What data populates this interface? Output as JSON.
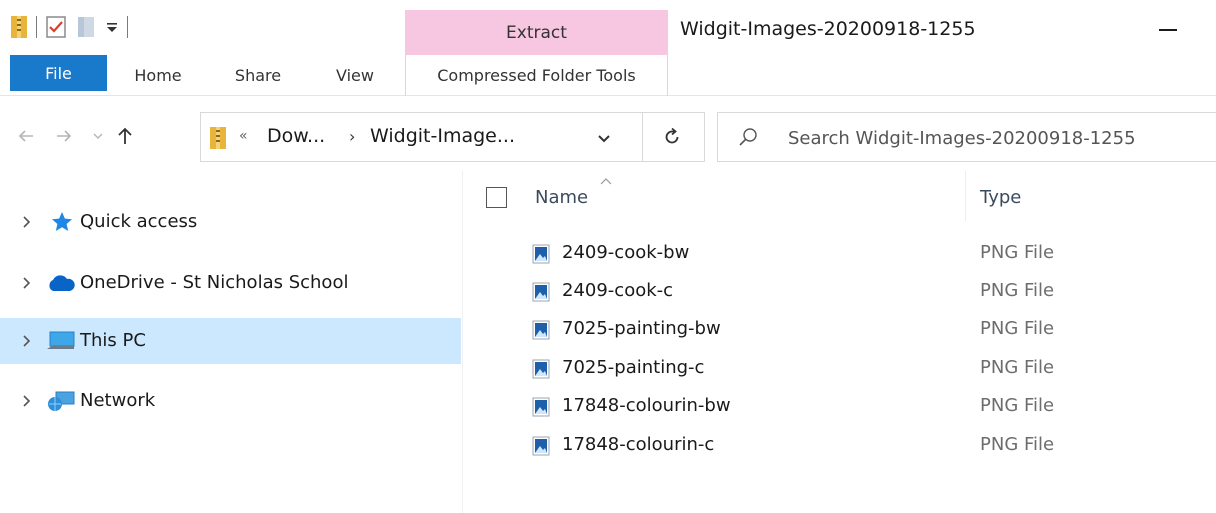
{
  "window": {
    "title": "Widgit-Images-20200918-1255",
    "context_tab": "Extract"
  },
  "ribbon": {
    "tabs": [
      {
        "label": "File"
      },
      {
        "label": "Home"
      },
      {
        "label": "Share"
      },
      {
        "label": "View"
      },
      {
        "label": "Compressed Folder Tools"
      }
    ]
  },
  "address": {
    "overflow": "«",
    "crumbs": [
      "Dow...",
      "Widgit-Image..."
    ],
    "separator": "›"
  },
  "search": {
    "placeholder": "Search Widgit-Images-20200918-1255"
  },
  "nav_pane": {
    "items": [
      {
        "label": "Quick access",
        "icon": "star-icon"
      },
      {
        "label": "OneDrive - St Nicholas School",
        "icon": "cloud-icon"
      },
      {
        "label": "This PC",
        "icon": "computer-icon",
        "selected": true
      },
      {
        "label": "Network",
        "icon": "network-icon"
      }
    ]
  },
  "file_list": {
    "columns": {
      "name": "Name",
      "type": "Type"
    },
    "files": [
      {
        "name": "2409-cook-bw",
        "type": "PNG File"
      },
      {
        "name": "2409-cook-c",
        "type": "PNG File"
      },
      {
        "name": "7025-painting-bw",
        "type": "PNG File"
      },
      {
        "name": "7025-painting-c",
        "type": "PNG File"
      },
      {
        "name": "17848-colourin-bw",
        "type": "PNG File"
      },
      {
        "name": "17848-colourin-c",
        "type": "PNG File"
      }
    ]
  },
  "colors": {
    "file_tab": "#1979ca",
    "context_tab": "#f7c6e0",
    "selection": "#cce8ff"
  }
}
